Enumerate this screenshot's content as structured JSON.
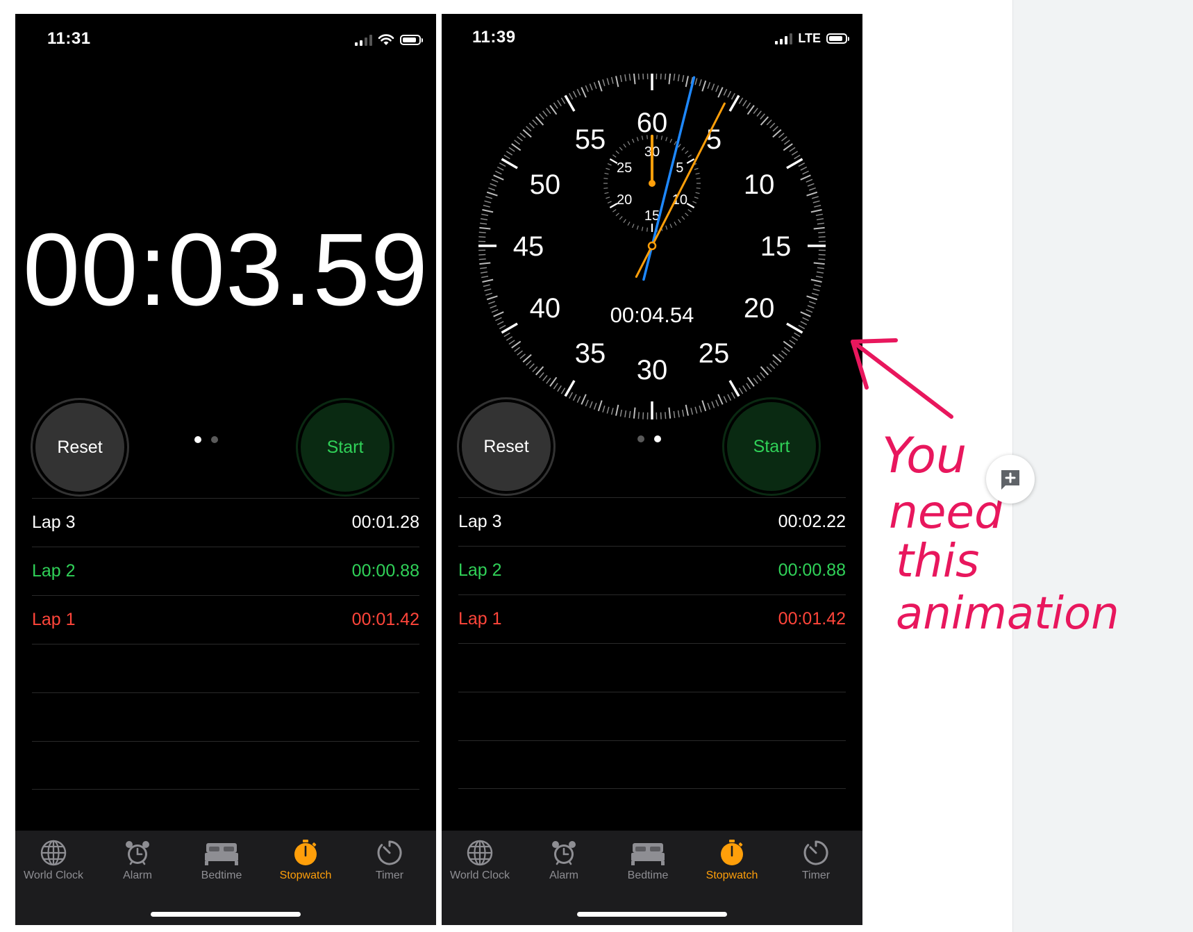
{
  "left_phone": {
    "status": {
      "time": "11:31"
    },
    "display_time": "00:03.59",
    "buttons": {
      "reset": "Reset",
      "start": "Start"
    },
    "laps": [
      {
        "label": "Lap 3",
        "time": "00:01.28",
        "color": "#ffffff"
      },
      {
        "label": "Lap 2",
        "time": "00:00.88",
        "color": "#30d158"
      },
      {
        "label": "Lap 1",
        "time": "00:01.42",
        "color": "#ff453a"
      }
    ]
  },
  "right_phone": {
    "status": {
      "time": "11:39",
      "network": "LTE"
    },
    "dial": {
      "digital_time": "00:04.54",
      "main_labels": [
        "60",
        "5",
        "10",
        "15",
        "20",
        "25",
        "30",
        "35",
        "40",
        "45",
        "50",
        "55"
      ],
      "sub_labels": [
        "30",
        "5",
        "10",
        "15",
        "20",
        "25"
      ]
    },
    "buttons": {
      "reset": "Reset",
      "start": "Start"
    },
    "laps": [
      {
        "label": "Lap 3",
        "time": "00:02.22",
        "color": "#ffffff"
      },
      {
        "label": "Lap 2",
        "time": "00:00.88",
        "color": "#30d158"
      },
      {
        "label": "Lap 1",
        "time": "00:01.42",
        "color": "#ff453a"
      }
    ]
  },
  "tabbar": {
    "items": [
      {
        "label": "World Clock",
        "icon": "globe-icon"
      },
      {
        "label": "Alarm",
        "icon": "alarm-clock-icon"
      },
      {
        "label": "Bedtime",
        "icon": "bed-icon"
      },
      {
        "label": "Stopwatch",
        "icon": "stopwatch-icon",
        "active": true
      },
      {
        "label": "Timer",
        "icon": "timer-icon"
      }
    ],
    "active_color": "#ff9f0a",
    "inactive_color": "#8e8e93"
  },
  "annotation": {
    "lines": [
      "You",
      "need",
      "this",
      "animation"
    ],
    "color": "#e8175d"
  },
  "colors": {
    "accent_green": "#30d158",
    "accent_red": "#ff453a",
    "hand_blue": "#1e88ff",
    "hand_orange": "#ff9f0a"
  }
}
